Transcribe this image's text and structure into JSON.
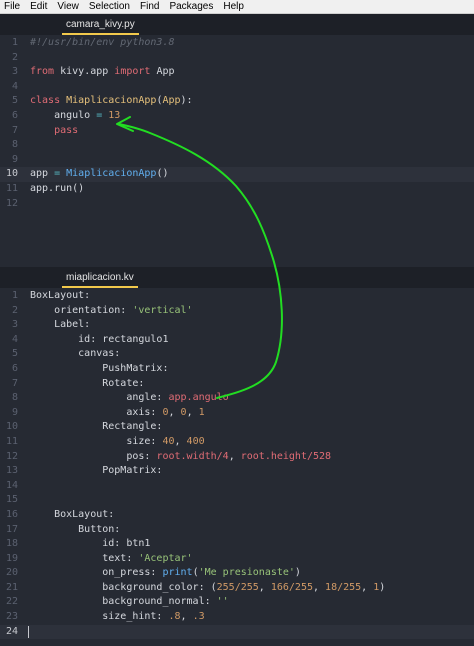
{
  "menubar": [
    "File",
    "Edit",
    "View",
    "Selection",
    "Find",
    "Packages",
    "Help"
  ],
  "top_pane": {
    "tab": "camara_kivy.py",
    "lines": [
      {
        "n": "1",
        "segments": [
          {
            "t": "#!/usr/bin/env python3.8",
            "c": "c-comment"
          }
        ]
      },
      {
        "n": "2",
        "segments": []
      },
      {
        "n": "3",
        "segments": [
          {
            "t": "from ",
            "c": "c-kw"
          },
          {
            "t": "kivy.app ",
            "c": ""
          },
          {
            "t": "import ",
            "c": "c-kw"
          },
          {
            "t": "App",
            "c": ""
          }
        ]
      },
      {
        "n": "4",
        "segments": []
      },
      {
        "n": "5",
        "segments": [
          {
            "t": "class ",
            "c": "c-kw"
          },
          {
            "t": "MiaplicacionApp",
            "c": "c-cls"
          },
          {
            "t": "(",
            "c": ""
          },
          {
            "t": "App",
            "c": "c-cls"
          },
          {
            "t": "):",
            "c": ""
          }
        ]
      },
      {
        "n": "6",
        "segments": [
          {
            "t": "    angulo ",
            "c": ""
          },
          {
            "t": "= ",
            "c": "c-op"
          },
          {
            "t": "13",
            "c": "c-num"
          }
        ]
      },
      {
        "n": "7",
        "segments": [
          {
            "t": "    pass",
            "c": "c-kw"
          }
        ]
      },
      {
        "n": "8",
        "segments": []
      },
      {
        "n": "9",
        "segments": []
      },
      {
        "n": "10",
        "active": true,
        "segments": [
          {
            "t": "app ",
            "c": ""
          },
          {
            "t": "= ",
            "c": "c-op"
          },
          {
            "t": "MiaplicacionApp",
            "c": "c-fn"
          },
          {
            "t": "()",
            "c": ""
          }
        ]
      },
      {
        "n": "11",
        "segments": [
          {
            "t": "app.run()",
            "c": ""
          }
        ]
      },
      {
        "n": "12",
        "segments": []
      }
    ]
  },
  "bottom_pane": {
    "tab": "miaplicacion.kv",
    "lines": [
      {
        "n": "1",
        "segments": [
          {
            "t": "BoxLayout:",
            "c": ""
          }
        ]
      },
      {
        "n": "2",
        "segments": [
          {
            "t": "    orientation: ",
            "c": ""
          },
          {
            "t": "'vertical'",
            "c": "c-str"
          }
        ]
      },
      {
        "n": "3",
        "segments": [
          {
            "t": "    Label:",
            "c": ""
          }
        ]
      },
      {
        "n": "4",
        "segments": [
          {
            "t": "        id: rectangulo1",
            "c": ""
          }
        ]
      },
      {
        "n": "5",
        "segments": [
          {
            "t": "        canvas:",
            "c": ""
          }
        ]
      },
      {
        "n": "6",
        "segments": [
          {
            "t": "            PushMatrix:",
            "c": ""
          }
        ]
      },
      {
        "n": "7",
        "segments": [
          {
            "t": "            Rotate:",
            "c": ""
          }
        ]
      },
      {
        "n": "8",
        "segments": [
          {
            "t": "                angle: ",
            "c": ""
          },
          {
            "t": "app.angulo",
            "c": "c-var"
          }
        ]
      },
      {
        "n": "9",
        "segments": [
          {
            "t": "                axis: ",
            "c": ""
          },
          {
            "t": "0",
            "c": "c-num"
          },
          {
            "t": ", ",
            "c": ""
          },
          {
            "t": "0",
            "c": "c-num"
          },
          {
            "t": ", ",
            "c": ""
          },
          {
            "t": "1",
            "c": "c-num"
          }
        ]
      },
      {
        "n": "10",
        "segments": [
          {
            "t": "            Rectangle:",
            "c": ""
          }
        ]
      },
      {
        "n": "11",
        "segments": [
          {
            "t": "                size: ",
            "c": ""
          },
          {
            "t": "40",
            "c": "c-num"
          },
          {
            "t": ", ",
            "c": ""
          },
          {
            "t": "400",
            "c": "c-num"
          }
        ]
      },
      {
        "n": "12",
        "segments": [
          {
            "t": "                pos: ",
            "c": ""
          },
          {
            "t": "root.width/4",
            "c": "c-var"
          },
          {
            "t": ", ",
            "c": ""
          },
          {
            "t": "root.height/528",
            "c": "c-var"
          }
        ]
      },
      {
        "n": "13",
        "segments": [
          {
            "t": "            PopMatrix:",
            "c": ""
          }
        ]
      },
      {
        "n": "14",
        "segments": []
      },
      {
        "n": "15",
        "segments": []
      },
      {
        "n": "16",
        "segments": [
          {
            "t": "    BoxLayout:",
            "c": ""
          }
        ]
      },
      {
        "n": "17",
        "segments": [
          {
            "t": "        Button:",
            "c": ""
          }
        ]
      },
      {
        "n": "18",
        "segments": [
          {
            "t": "            id: btn1",
            "c": ""
          }
        ]
      },
      {
        "n": "19",
        "segments": [
          {
            "t": "            text: ",
            "c": ""
          },
          {
            "t": "'Aceptar'",
            "c": "c-str"
          }
        ]
      },
      {
        "n": "20",
        "segments": [
          {
            "t": "            on_press: ",
            "c": ""
          },
          {
            "t": "print",
            "c": "c-fn"
          },
          {
            "t": "(",
            "c": ""
          },
          {
            "t": "'Me presionaste'",
            "c": "c-str"
          },
          {
            "t": ")",
            "c": ""
          }
        ]
      },
      {
        "n": "21",
        "segments": [
          {
            "t": "            background_color: (",
            "c": ""
          },
          {
            "t": "255/255",
            "c": "c-num"
          },
          {
            "t": ", ",
            "c": ""
          },
          {
            "t": "166/255",
            "c": "c-num"
          },
          {
            "t": ", ",
            "c": ""
          },
          {
            "t": "18/255",
            "c": "c-num"
          },
          {
            "t": ", ",
            "c": ""
          },
          {
            "t": "1",
            "c": "c-num"
          },
          {
            "t": ")",
            "c": ""
          }
        ]
      },
      {
        "n": "22",
        "segments": [
          {
            "t": "            background_normal: ",
            "c": ""
          },
          {
            "t": "''",
            "c": "c-str"
          }
        ]
      },
      {
        "n": "23",
        "segments": [
          {
            "t": "            size_hint: ",
            "c": ""
          },
          {
            "t": ".8",
            "c": "c-num"
          },
          {
            "t": ", ",
            "c": ""
          },
          {
            "t": ".3",
            "c": "c-num"
          }
        ]
      },
      {
        "n": "24",
        "active": true,
        "segments": []
      }
    ]
  },
  "colors": {
    "annotation_arrow": "#22dd22",
    "tab_underline": "#f2c94c"
  }
}
